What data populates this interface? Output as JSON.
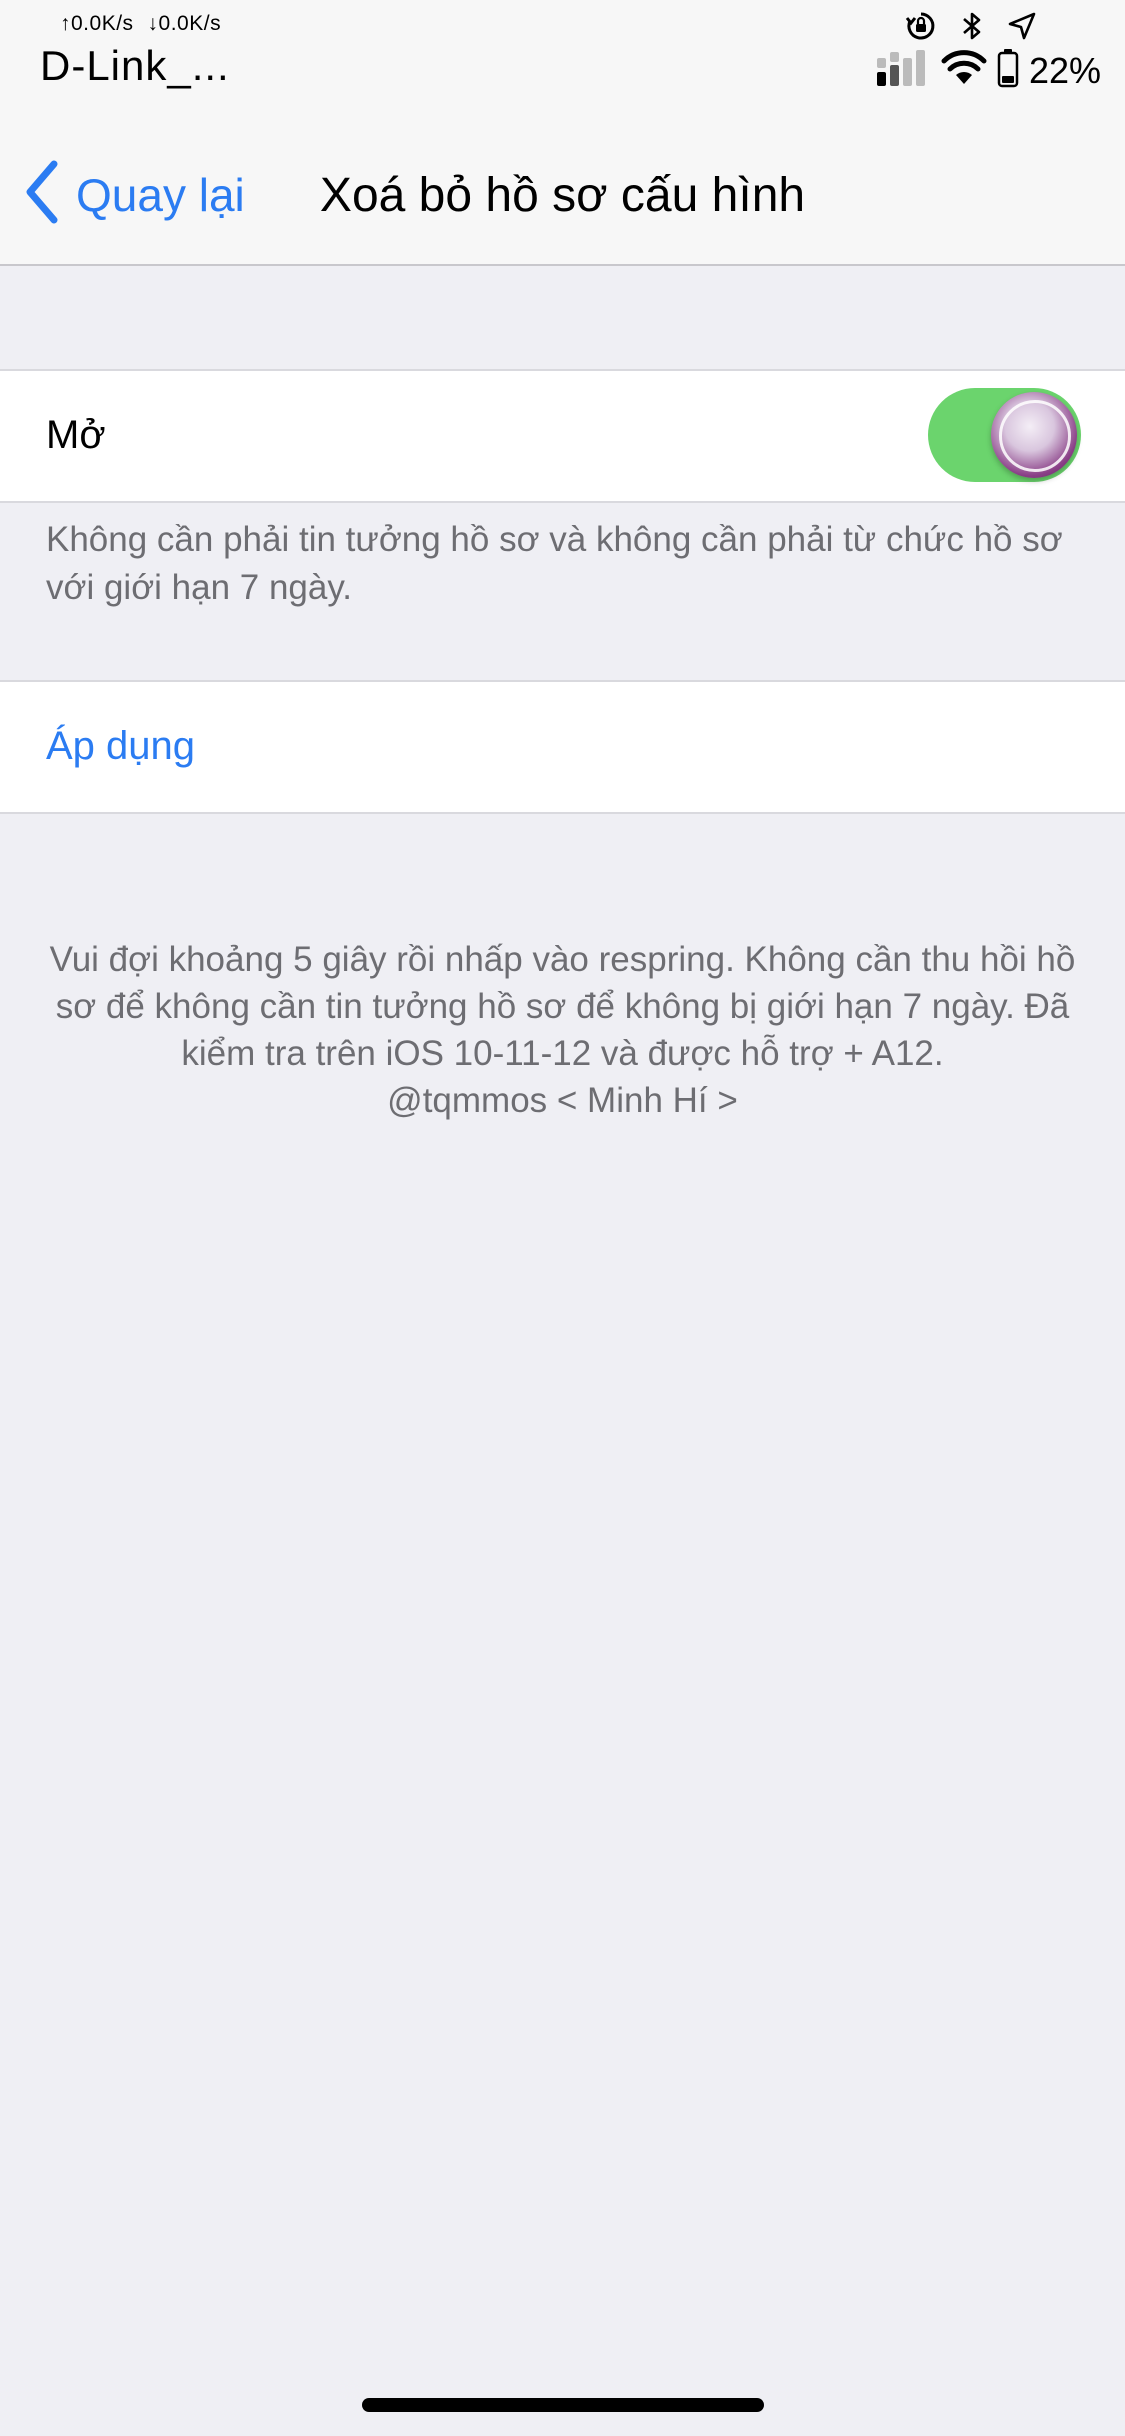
{
  "status_bar": {
    "upload_speed": "↑0.0K/s",
    "download_speed": "↓0.0K/s",
    "carrier": "D-Link_...",
    "battery_percent": "22%"
  },
  "nav": {
    "back_label": "Quay lại",
    "title": "Xoá bỏ hồ sơ cấu hình"
  },
  "settings": {
    "open_label": "Mở",
    "open_toggle_on": true,
    "open_footer": "Không cần phải tin tưởng hồ sơ và không cần phải từ chức hồ sơ với giới hạn 7 ngày.",
    "apply_label": "Áp dụng"
  },
  "info": {
    "line1": "Vui đợi khoảng 5 giây rồi nhấp vào respring. Không cần thu hồi hồ sơ để không cần tin tưởng hồ sơ để không bị giới hạn 7 ngày. Đã kiểm tra trên iOS 10-11-12 và được hỗ trợ + A12.",
    "line2": "@tqmmos < Minh Hí >"
  },
  "colors": {
    "accent": "#2b7cf2",
    "toggle_on": "#6bd46d",
    "background": "#efeff4",
    "secondary_text": "#6d6d72"
  },
  "icons": [
    "orientation-lock-icon",
    "bluetooth-icon",
    "location-arrow-icon",
    "cellular-signal-icon",
    "wifi-icon",
    "battery-icon",
    "back-chevron-icon"
  ]
}
